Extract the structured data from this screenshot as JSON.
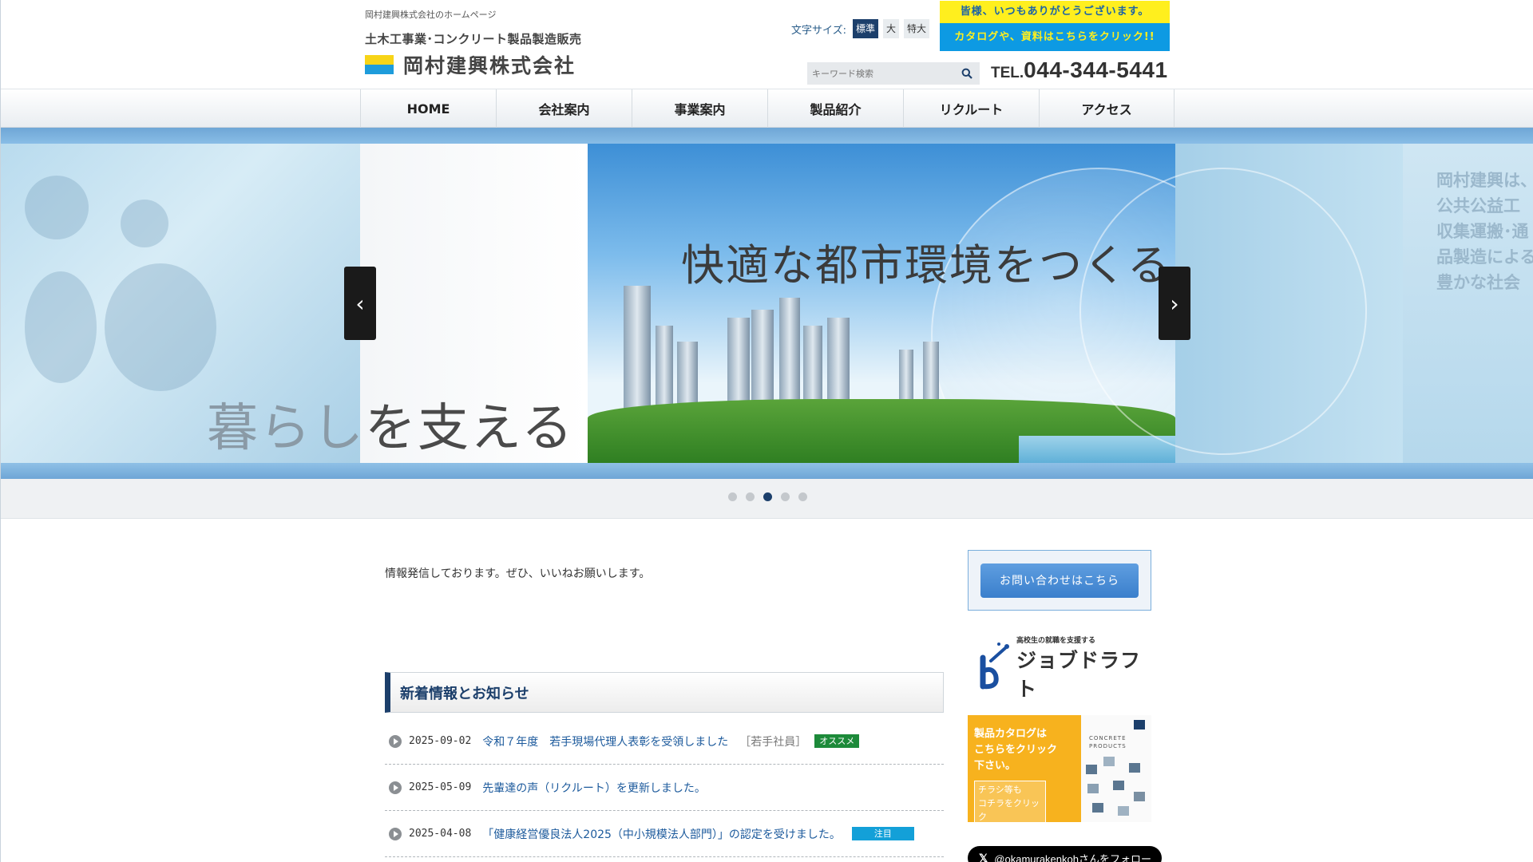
{
  "header": {
    "tagline": "岡村建興株式会社のホームページ",
    "subtitle": "土木工事業･コンクリート製品製造販売",
    "company_name": "岡村建興株式会社",
    "font_size": {
      "label": "文字サイズ:",
      "options": [
        "標準",
        "大",
        "特大"
      ],
      "selected": "標準"
    },
    "cta_top": "皆様、いつもありがとうございます。",
    "cta_bottom": "カタログや、資料はこちらをクリック!!",
    "search_placeholder": "キーワード検索",
    "tel_prefix": "TEL.",
    "tel_number": "044-344-5441"
  },
  "nav": {
    "items": [
      "HOME",
      "会社案内",
      "事業案内",
      "製品紹介",
      "リクルート",
      "アクセス"
    ]
  },
  "slider": {
    "headline": "快適な都市環境をつくる",
    "footline_dim": "暮らし",
    "footline": "を支える",
    "far_text": [
      "岡村建興は、",
      "公共公益工",
      "収集運搬･通",
      "品製造による",
      "豊かな社会"
    ],
    "prev_label": "‹",
    "next_label": "›",
    "slide_count": 5,
    "active_index": 2
  },
  "main": {
    "intro": "情報発信しております。ぜひ、いいねお願いします。",
    "news_heading": "新着情報とお知らせ",
    "news": [
      {
        "date": "2025-09-02",
        "title": "令和７年度　若手現場代理人表彰を受領しました",
        "category": "［若手社員］",
        "badge": "オススメ",
        "badge_color": "#1d8a3a"
      },
      {
        "date": "2025-05-09",
        "title": "先輩達の声（リクルート）を更新しました。",
        "category": "",
        "badge": "",
        "badge_color": ""
      },
      {
        "date": "2025-04-08",
        "title": "「健康経営優良法人2025（中小規模法人部門）」の認定を受けました。",
        "category": "",
        "badge": "注目",
        "badge_color": "#13a0d8"
      }
    ]
  },
  "sidebar": {
    "contact_button": "お問い合わせはこちら",
    "jobdraft_small": "高校生の就職を支援する",
    "jobdraft_big": "ジョブドラフト",
    "catalog_main": "製品カタログは\nこちらをクリック\n下さい。",
    "catalog_sub": "チラシ等も\nコチラをクリック",
    "catalog_pic_label": "CONCRETE\nPRODUCTS",
    "x_follow": "@okamurakenkohさんをフォロー"
  },
  "colors": {
    "navy": "#1c3f6b",
    "link": "#1c5a9c",
    "cta_yellow": "#ffef1e",
    "cta_blue": "#0d9ae3",
    "catalog_orange": "#f7b21e"
  }
}
